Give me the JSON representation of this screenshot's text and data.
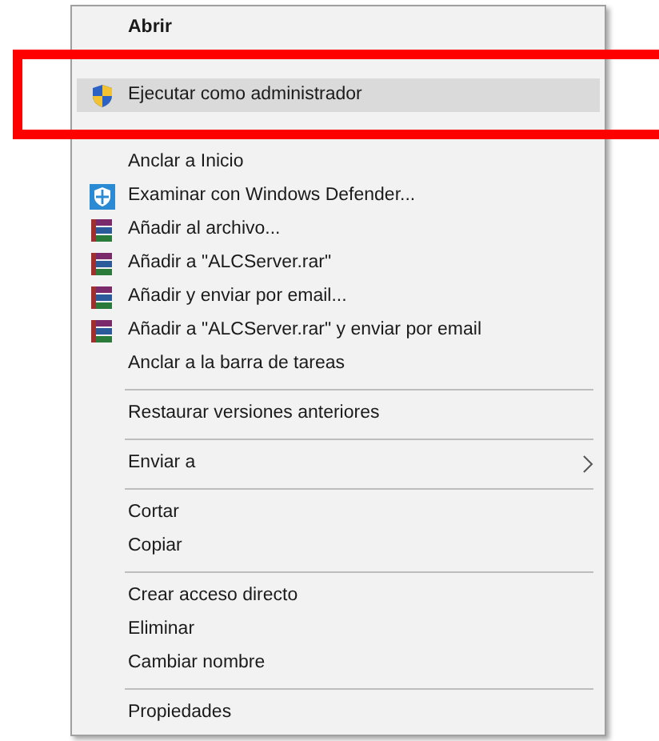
{
  "menu": {
    "items": [
      {
        "kind": "default",
        "label": "Abrir",
        "selected": false
      },
      {
        "kind": "covered"
      },
      {
        "kind": "uac",
        "label": "Ejecutar como administrador",
        "selected": true
      },
      {
        "kind": "covered"
      },
      {
        "kind": "plain",
        "label": "Anclar a Inicio",
        "selected": false
      },
      {
        "kind": "scan",
        "label": "Examinar con Windows Defender...",
        "selected": false
      },
      {
        "kind": "archive",
        "label": "Añadir al archivo...",
        "selected": false
      },
      {
        "kind": "archive",
        "label": "Añadir a \"ALCServer.rar\"",
        "selected": false
      },
      {
        "kind": "archive",
        "label": "Añadir y enviar por email...",
        "selected": false
      },
      {
        "kind": "archive",
        "label": "Añadir a \"ALCServer.rar\" y enviar por email",
        "selected": false
      },
      {
        "kind": "plain",
        "label": "Anclar a la barra de tareas",
        "selected": false
      },
      {
        "kind": "separator"
      },
      {
        "kind": "plain",
        "label": "Restaurar versiones anteriores",
        "selected": false
      },
      {
        "kind": "separator"
      },
      {
        "kind": "submenu",
        "label": "Enviar a",
        "selected": false
      },
      {
        "kind": "separator"
      },
      {
        "kind": "plain",
        "label": "Cortar",
        "selected": false
      },
      {
        "kind": "plain",
        "label": "Copiar",
        "selected": false
      },
      {
        "kind": "separator"
      },
      {
        "kind": "plain",
        "label": "Crear acceso directo",
        "selected": false
      },
      {
        "kind": "plain",
        "label": "Eliminar",
        "selected": false
      },
      {
        "kind": "plain",
        "label": "Cambiar nombre",
        "selected": false
      },
      {
        "kind": "separator"
      },
      {
        "kind": "plain",
        "label": "Propiedades",
        "selected": false
      }
    ]
  }
}
